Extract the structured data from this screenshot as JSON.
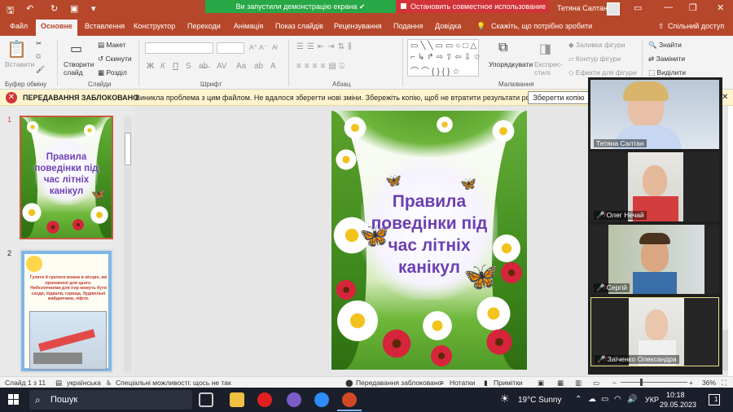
{
  "titlebar": {
    "share_notice": "Ви запустили демонстрацію екрана",
    "stop_share": "Остановить совместное использование",
    "user": "Тетяна Салтан"
  },
  "tabs": [
    {
      "label": "Файл"
    },
    {
      "label": "Основне"
    },
    {
      "label": "Вставлення"
    },
    {
      "label": "Конструктор"
    },
    {
      "label": "Переходи"
    },
    {
      "label": "Анімація"
    },
    {
      "label": "Показ слайдів"
    },
    {
      "label": "Рецензування"
    },
    {
      "label": "Подання"
    },
    {
      "label": "Довідка"
    },
    {
      "label": "Скажіть, що потрібно зробити"
    },
    {
      "label": "Спільний доступ"
    }
  ],
  "ribbon": {
    "paste": "Вставити",
    "clipboard": "Буфер обміну",
    "new_slide": "Створити слайд",
    "layout": "Макет",
    "reset": "Скинути",
    "section": "Розділ",
    "slides": "Слайди",
    "font": "Шрифт",
    "paragraph": "Абзац",
    "arrange": "Упорядкувати",
    "quick_styles": "Експрес-стилі",
    "shape_fill": "Заливка фігури",
    "shape_outline": "Контур фігури",
    "shape_effects": "Ефекти для фігури",
    "drawing": "Малювання",
    "find": "Знайти",
    "replace": "Замінити",
    "select": "Виділити"
  },
  "infobar": {
    "title": "ПЕРЕДАВАННЯ ЗАБЛОКОВАНО",
    "message": "Виникла проблема з цим файлом. Не вдалося зберегти нові зміни. Збережіть копію, щоб не втратити результати роботи.",
    "button": "Зберегти копію"
  },
  "slides": [
    {
      "number": "1",
      "title_lines": [
        "Правила",
        "поведінки під",
        "час  літніх",
        "канікул"
      ]
    },
    {
      "number": "2",
      "text": "Гуляти й гратися можна в місцях, які призначені для цього. Небезпечними для ігор можуть бути сходи, підвали, горища, будівельні майданчики, ліфти."
    }
  ],
  "main_slide": {
    "title_lines": [
      "Правила",
      "поведінки під",
      "час  літніх",
      "канікул"
    ]
  },
  "participants": [
    {
      "name": "Тетяна Салтан",
      "muted": false
    },
    {
      "name": "Олег Нечай",
      "muted": true
    },
    {
      "name": "Сергій",
      "muted": true
    },
    {
      "name": "Заїченко Олександра",
      "muted": true
    }
  ],
  "statusbar": {
    "slide": "Слайд 1 з 11",
    "language": "українська",
    "accessibility": "Спеціальні можливості: щось не так",
    "sync": "Передавання заблоковано",
    "notes": "Нотатки",
    "comments": "Примітки",
    "zoom": "36%"
  },
  "taskbar": {
    "search": "Пошук",
    "weather": "19°C  Sunny",
    "lang": "УКР",
    "time": "10:18",
    "date": "29.05.2023",
    "notif": "1"
  },
  "colors": {
    "accent": "#b7472a",
    "title_purple": "#6b3fb3",
    "banner_green": "#27a745",
    "stop_red": "#d13438"
  }
}
